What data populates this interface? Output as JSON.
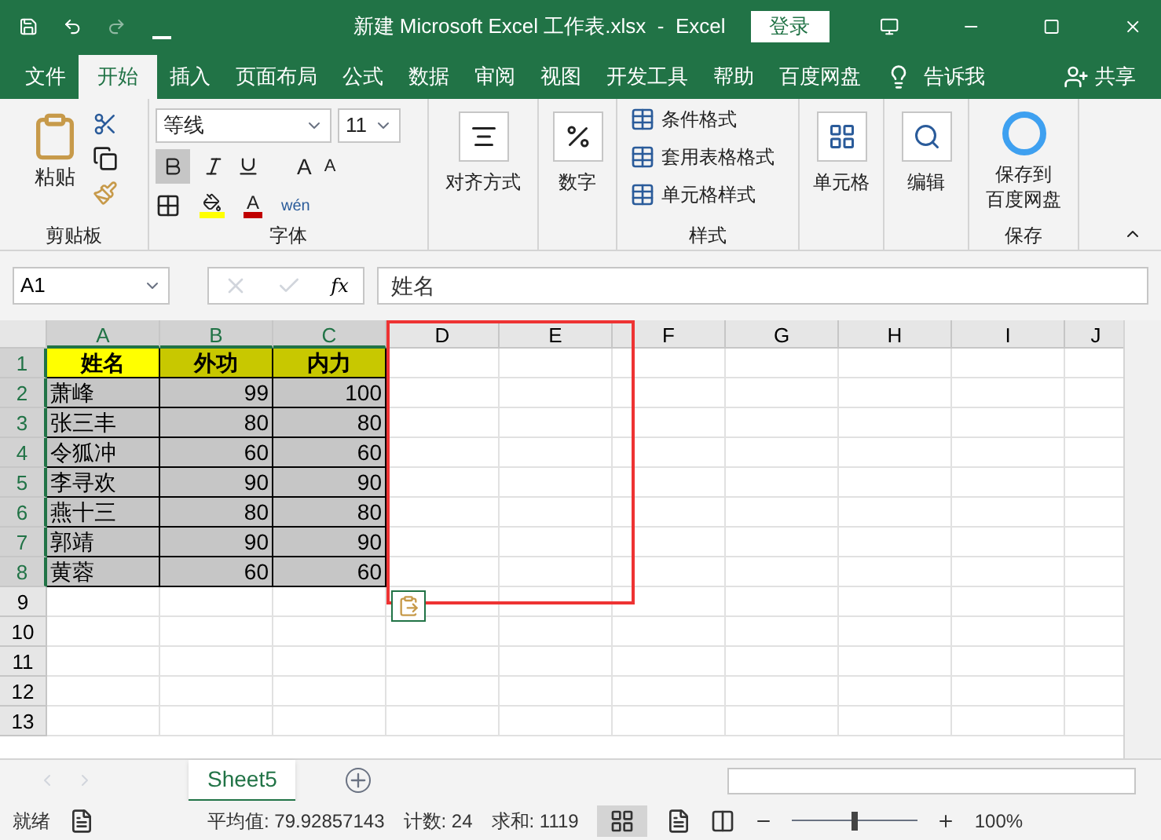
{
  "window": {
    "title": "新建 Microsoft Excel 工作表.xlsx  -  Excel",
    "login": "登录"
  },
  "ribbon_tabs": [
    {
      "label": "文件",
      "selected": false
    },
    {
      "label": "开始",
      "selected": true
    },
    {
      "label": "插入",
      "selected": false
    },
    {
      "label": "页面布局",
      "selected": false
    },
    {
      "label": "公式",
      "selected": false
    },
    {
      "label": "数据",
      "selected": false
    },
    {
      "label": "审阅",
      "selected": false
    },
    {
      "label": "视图",
      "selected": false
    },
    {
      "label": "开发工具",
      "selected": false
    },
    {
      "label": "帮助",
      "selected": false
    },
    {
      "label": "百度网盘",
      "selected": false
    }
  ],
  "tell_me": "告诉我",
  "share": "共享",
  "ribbon": {
    "clipboard": {
      "paste": "粘贴",
      "label": "剪贴板"
    },
    "font": {
      "name": "等线",
      "size": "11",
      "bold": true,
      "label": "字体",
      "phonetic": "wén",
      "grow": "A",
      "shrink": "A",
      "font_color_letter": "A"
    },
    "align": "对齐方式",
    "number": "数字",
    "styles": {
      "items": [
        "条件格式",
        "套用表格格式",
        "单元格样式"
      ],
      "label": "样式"
    },
    "cells": "单元格",
    "editing": "编辑",
    "save": {
      "button": [
        "保存到",
        "百度网盘"
      ],
      "label": "保存"
    }
  },
  "formula_bar": {
    "name_box": "A1",
    "fx": "fx",
    "value": "姓名"
  },
  "sheet": {
    "columns": [
      "A",
      "B",
      "C",
      "D",
      "E",
      "F",
      "G",
      "H",
      "I",
      "J"
    ],
    "rows": [
      {
        "header": "1",
        "kind": "header",
        "selected": true,
        "cells": [
          "姓名",
          "外功",
          "内力"
        ]
      },
      {
        "header": "2",
        "kind": "data",
        "selected": true,
        "cells": [
          "萧峰",
          "99",
          "100"
        ]
      },
      {
        "header": "3",
        "kind": "data",
        "selected": true,
        "cells": [
          "张三丰",
          "80",
          "80"
        ]
      },
      {
        "header": "4",
        "kind": "data",
        "selected": true,
        "cells": [
          "令狐冲",
          "60",
          "60"
        ]
      },
      {
        "header": "5",
        "kind": "data",
        "selected": true,
        "cells": [
          "李寻欢",
          "90",
          "90"
        ]
      },
      {
        "header": "6",
        "kind": "data",
        "selected": true,
        "cells": [
          "燕十三",
          "80",
          "80"
        ]
      },
      {
        "header": "7",
        "kind": "data",
        "selected": true,
        "cells": [
          "郭靖",
          "90",
          "90"
        ]
      },
      {
        "header": "8",
        "kind": "data",
        "selected": true,
        "cells": [
          "黄蓉",
          "60",
          "60"
        ]
      },
      {
        "header": "9",
        "kind": "empty",
        "selected": false,
        "cells": []
      },
      {
        "header": "10",
        "kind": "empty",
        "selected": false,
        "cells": []
      },
      {
        "header": "11",
        "kind": "empty",
        "selected": false,
        "cells": []
      },
      {
        "header": "12",
        "kind": "empty",
        "selected": false,
        "cells": []
      },
      {
        "header": "13",
        "kind": "empty",
        "selected": false,
        "cells": []
      }
    ]
  },
  "sheet_tabs": [
    {
      "label": "Sheet5",
      "selected": true
    }
  ],
  "status_bar": {
    "ready": "就绪",
    "average": "平均值: 79.92857143",
    "count": "计数: 24",
    "sum": "求和: 1119",
    "zoom": "100%",
    "zoom_slider": {
      "level": 0.5
    }
  }
}
